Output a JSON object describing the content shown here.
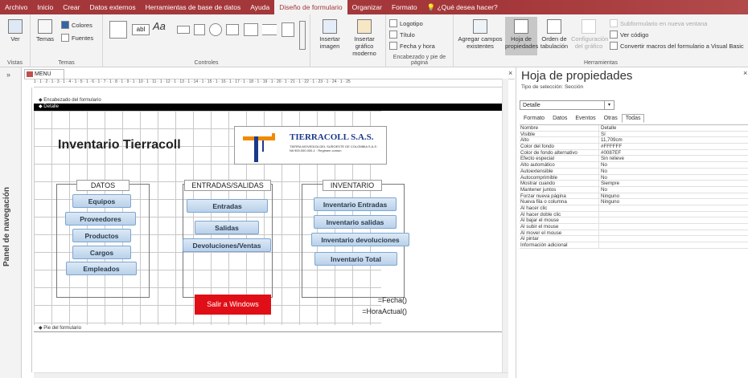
{
  "menu": {
    "items": [
      "Archivo",
      "Inicio",
      "Crear",
      "Datos externos",
      "Herramientas de base de datos",
      "Ayuda",
      "Diseño de formulario",
      "Organizar",
      "Formato"
    ],
    "active": "Diseño de formulario",
    "tell_me": "¿Qué desea hacer?"
  },
  "ribbon": {
    "vistas": {
      "label": "Vistas",
      "ver": "Ver"
    },
    "temas": {
      "label": "Temas",
      "temas": "Temas",
      "colores": "Colores",
      "fuentes": "Fuentes"
    },
    "controles": {
      "label": "Controles",
      "aa": "Aa",
      "abl": "abl"
    },
    "insertar": {
      "imagen": "Insertar imagen",
      "grafico": "Insertar gráfico moderno"
    },
    "encabezado": {
      "label": "Encabezado y pie de página",
      "logotipo": "Logotipo",
      "titulo": "Título",
      "fecha": "Fecha y hora"
    },
    "herramientas": {
      "label": "Herramientas",
      "agregar": "Agregar campos existentes",
      "hoja": "Hoja de propiedades",
      "orden": "Orden de tabulación",
      "config": "Configuración del gráfico",
      "subform": "Subformulario en nueva ventana",
      "codigo": "Ver código",
      "convertir": "Convertir macros del formulario a Visual Basic"
    }
  },
  "nav": {
    "label": "Panel de navegación",
    "chevron": "»"
  },
  "doc": {
    "tab": "MENU",
    "close": "×",
    "ruler": "1 · 1 · 2 · 1 · 3 · 1 · 4 · 1 · 5 · 1 · 6 · 1 · 7 · 1 · 8 · 1 · 9 · 1 · 10 · 1 · 11 · 1 · 12 · 1 · 13 · 1 · 14 · 1 · 15 · 1 · 16 · 1 · 17 · 1 · 18 · 1 · 19 · 1 · 20 · 1 · 21 · 1 · 22 · 1 · 23 · 1 · 24 · 1 · 25",
    "sections": {
      "header": "Encabezado del formulario",
      "detail": "Detalle",
      "footer": "Pie del formulario"
    },
    "form": {
      "title": "Inventario Tierracoll",
      "logo_brand": "TIERRACOLL S.A.S.",
      "logo_sub": "TIERRA MOVEDIZA DEL SUROESTE DE COLOMBIA S.A.S · Nit 900.000.000-1 · Regimen común",
      "groups": {
        "datos": {
          "label": "DATOS",
          "buttons": [
            "Equipos",
            "Proveedores",
            "Productos",
            "Cargos",
            "Empleados"
          ]
        },
        "es": {
          "label": "ENTRADAS/SALIDAS",
          "buttons": [
            "Entradas",
            "Salidas",
            "Devoluciones/Ventas"
          ]
        },
        "inv": {
          "label": "INVENTARIO",
          "buttons": [
            "Inventario Entradas",
            "Inventario salidas",
            "Inventario devoluciones",
            "Inventario Total"
          ]
        }
      },
      "exit_button": "Salir a Windows",
      "fecha": "=Fecha()",
      "hora": "=HoraActual()"
    }
  },
  "props": {
    "title": "Hoja de propiedades",
    "subtitle": "Tipo de selección: Sección",
    "close": "×",
    "selection": "Detalle",
    "tabs": [
      "Formato",
      "Datos",
      "Eventos",
      "Otras",
      "Todas"
    ],
    "active_tab": "Todas",
    "rows": [
      [
        "Nombre",
        "Detalle"
      ],
      [
        "Visible",
        "Sí"
      ],
      [
        "Alto",
        "11,709cm"
      ],
      [
        "Color del fondo",
        "#FFFFFF"
      ],
      [
        "Color de fondo alternativo",
        "#0087EF"
      ],
      [
        "Efecto especial",
        "Sin relieve"
      ],
      [
        "Alto automático",
        "No"
      ],
      [
        "Autoextensible",
        "No"
      ],
      [
        "Autocomprimible",
        "No"
      ],
      [
        "Mostrar cuando",
        "Siempre"
      ],
      [
        "Mantener juntos",
        "No"
      ],
      [
        "Forzar nueva página",
        "Ninguno"
      ],
      [
        "Nueva fila o columna",
        "Ninguno"
      ],
      [
        "Al hacer clic",
        ""
      ],
      [
        "Al hacer doble clic",
        ""
      ],
      [
        "Al bajar el mouse",
        ""
      ],
      [
        "Al subir el mouse",
        ""
      ],
      [
        "Al mover el mouse",
        ""
      ],
      [
        "Al pintar",
        ""
      ],
      [
        "Información adicional",
        ""
      ]
    ]
  }
}
